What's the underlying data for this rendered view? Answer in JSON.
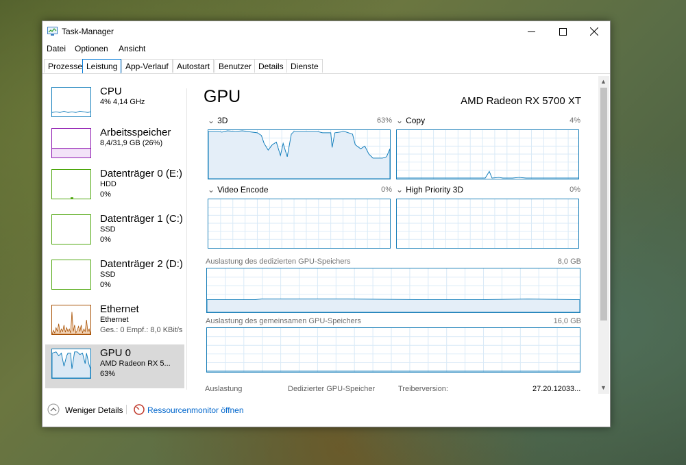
{
  "window": {
    "title": "Task-Manager",
    "controls": {
      "minimize": "—",
      "maximize": "☐",
      "close": "✕"
    }
  },
  "menu": {
    "items": [
      "Datei",
      "Optionen",
      "Ansicht"
    ]
  },
  "tabs": [
    "Prozesse",
    "Leistung",
    "App-Verlauf",
    "Autostart",
    "Benutzer",
    "Details",
    "Dienste"
  ],
  "active_tab": "Leistung",
  "sidebar": {
    "items": [
      {
        "title": "CPU",
        "sub1": "4% 4,14 GHz",
        "sub2": "",
        "color": "#117dbb"
      },
      {
        "title": "Arbeitsspeicher",
        "sub1": "8,4/31,9 GB (26%)",
        "sub2": "",
        "color": "#8b12ae"
      },
      {
        "title": "Datenträger 0 (E:)",
        "sub1": "HDD",
        "sub2": "0%",
        "color": "#4da60c"
      },
      {
        "title": "Datenträger 1 (C:)",
        "sub1": "SSD",
        "sub2": "0%",
        "color": "#4da60c"
      },
      {
        "title": "Datenträger 2 (D:)",
        "sub1": "SSD",
        "sub2": "0%",
        "color": "#4da60c"
      },
      {
        "title": "Ethernet",
        "sub1": "Ethernet",
        "sub2": "Ges.: 0 Empf.: 8,0 KBit/s",
        "color": "#a74f01"
      },
      {
        "title": "GPU 0",
        "sub1": "AMD Radeon RX 5...",
        "sub2": "63%",
        "color": "#117dbb"
      }
    ]
  },
  "main": {
    "title": "GPU",
    "model": "AMD Radeon RX 5700 XT",
    "engines": [
      {
        "name": "3D",
        "percent": "63%"
      },
      {
        "name": "Copy",
        "percent": "4%"
      },
      {
        "name": "Video Encode",
        "percent": "0%"
      },
      {
        "name": "High Priority 3D",
        "percent": "0%"
      }
    ],
    "dedicated_memory": {
      "label": "Auslastung des dedizierten GPU-Speichers",
      "max": "8,0 GB"
    },
    "shared_memory": {
      "label": "Auslastung des gemeinsamen GPU-Speichers",
      "max": "16,0 GB"
    },
    "stats": {
      "usage_label": "Auslastung",
      "dedicated_label": "Dedizierter GPU-Speicher",
      "driver_label": "Treiberversion:",
      "driver_value": "27.20.12033..."
    }
  },
  "footer": {
    "fewer_details": "Weniger Details",
    "resource_monitor": "Ressourcenmonitor öffnen"
  },
  "colors": {
    "accent": "#0078d7",
    "gpu_line": "#117dbb",
    "link": "#0066cc"
  }
}
